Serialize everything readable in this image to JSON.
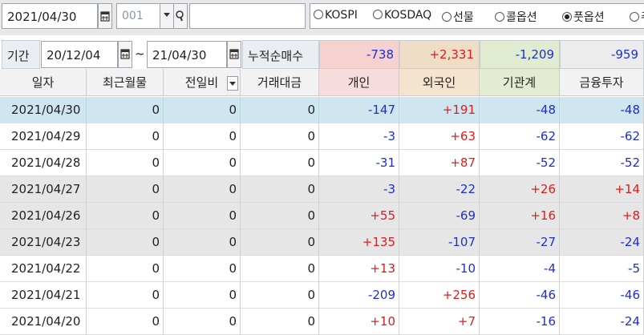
{
  "toolbar": {
    "date": "2021/04/30",
    "code": "001",
    "search_value": "",
    "radios": [
      {
        "label": "KOSPI",
        "checked": false
      },
      {
        "label": "KOSDAQ",
        "checked": false
      },
      {
        "label": "선물",
        "checked": false
      },
      {
        "label": "콜옵션",
        "checked": false
      },
      {
        "label": "풋옵션",
        "checked": true
      },
      {
        "label": "주",
        "checked": false
      }
    ]
  },
  "period": {
    "label": "기간",
    "from": "20/12/04",
    "tilde": "~",
    "to": "21/04/30",
    "sum_label": "누적순매수",
    "sums": [
      "-738",
      "+2,331",
      "-1,209",
      "-959"
    ]
  },
  "table": {
    "headers": [
      "일자",
      "최근월물",
      "전일비",
      "거래대금",
      "개인",
      "외국인",
      "기관계",
      "금융투자"
    ],
    "rows": [
      [
        "2021/04/30",
        "0",
        "0",
        "0",
        "-147",
        "+191",
        "-48",
        "-48"
      ],
      [
        "2021/04/29",
        "0",
        "0",
        "0",
        "-3",
        "+63",
        "-62",
        "-62"
      ],
      [
        "2021/04/28",
        "0",
        "0",
        "0",
        "-31",
        "+87",
        "-52",
        "-52"
      ],
      [
        "2021/04/27",
        "0",
        "0",
        "0",
        "-3",
        "-22",
        "+26",
        "+14"
      ],
      [
        "2021/04/26",
        "0",
        "0",
        "0",
        "+55",
        "-69",
        "+16",
        "+8"
      ],
      [
        "2021/04/23",
        "0",
        "0",
        "0",
        "+135",
        "-107",
        "-27",
        "-24"
      ],
      [
        "2021/04/22",
        "0",
        "0",
        "0",
        "+13",
        "-10",
        "-4",
        "-5"
      ],
      [
        "2021/04/21",
        "0",
        "0",
        "0",
        "-209",
        "+256",
        "-46",
        "-46"
      ],
      [
        "2021/04/20",
        "0",
        "0",
        "0",
        "+10",
        "+7",
        "-16",
        "-24"
      ]
    ]
  },
  "colors": {
    "selected_row": "#cfe6f1",
    "gray_row": "#e6e6e6",
    "white_row": "#ffffff",
    "header_individual": "#f6dcdc",
    "header_foreign": "#f4e4cf",
    "header_institution": "#e3ecd2",
    "sum_individual": "#f7d0d0",
    "sum_foreign": "#f0ddc6",
    "sum_institution": "#e0ebcf",
    "sum_financial": "#ececec",
    "positive": "#e01b1b",
    "negative": "#1c2fd0"
  },
  "icons": {
    "calendar": "calendar-icon",
    "dropdown": "chevron-down-icon",
    "search": "search-icon"
  }
}
